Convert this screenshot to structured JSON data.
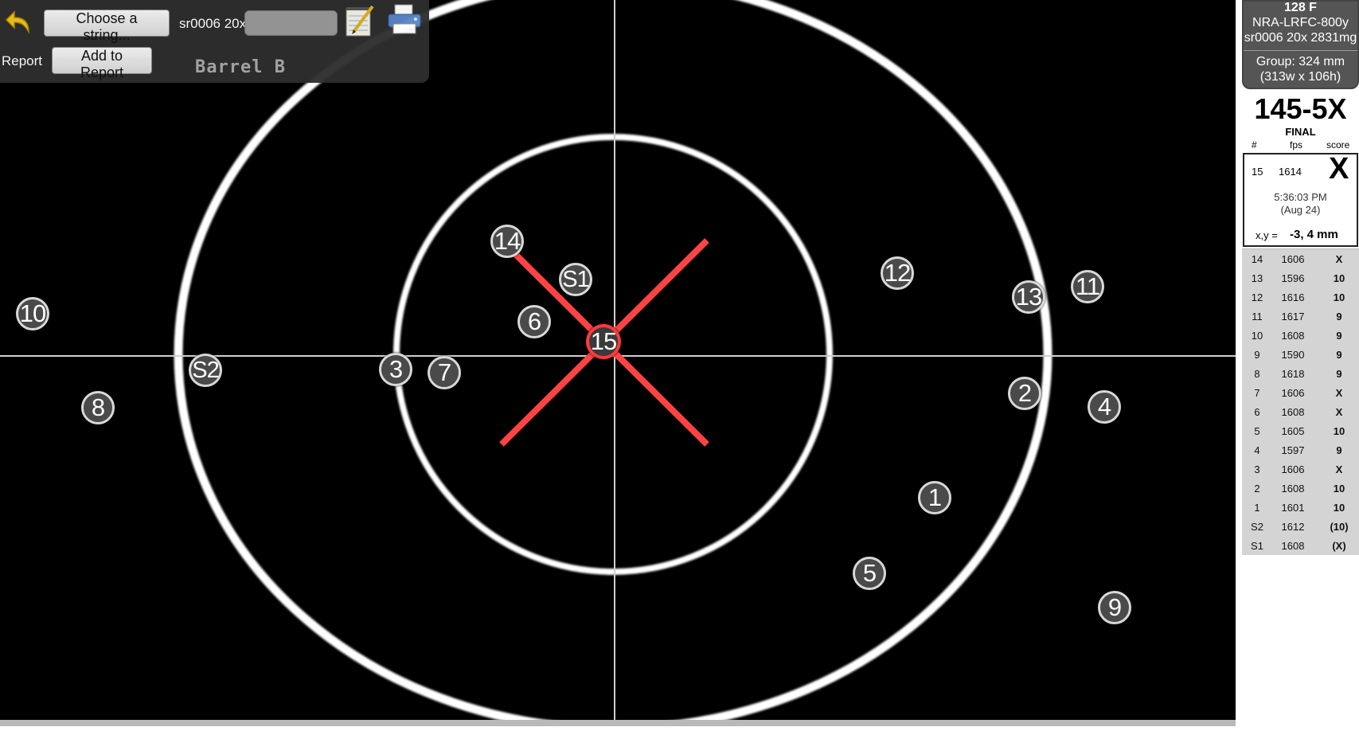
{
  "toolbar": {
    "choose_label": "Choose a string...",
    "string_prefix": "sr0006 20x",
    "report_label": "Report",
    "add_report_label": "Add to Report",
    "barrel_label": "Barrel B",
    "icons": [
      "undo-arrow-icon",
      "notepad-icon",
      "printer-icon"
    ]
  },
  "panel": {
    "temp": "128 F",
    "match": "NRA-LRFC-800y",
    "string": "sr0006 20x 2831mg",
    "group": "Group: 324 mm",
    "group_dims": "(313w x 106h)",
    "total": "145-5X",
    "status": "FINAL",
    "headers": {
      "num": "#",
      "fps": "fps",
      "score": "score"
    },
    "last_shot": {
      "num": "15",
      "fps": "1614",
      "score": "X",
      "time": "5:36:03 PM",
      "date": "(Aug 24)",
      "xy_label": "x,y =",
      "xy_value": "-3, 4 mm"
    },
    "rows": [
      {
        "num": "14",
        "fps": "1606",
        "score": "X"
      },
      {
        "num": "13",
        "fps": "1596",
        "score": "10"
      },
      {
        "num": "12",
        "fps": "1616",
        "score": "10"
      },
      {
        "num": "11",
        "fps": "1617",
        "score": "9"
      },
      {
        "num": "10",
        "fps": "1608",
        "score": "9"
      },
      {
        "num": "9",
        "fps": "1590",
        "score": "9"
      },
      {
        "num": "8",
        "fps": "1618",
        "score": "9"
      },
      {
        "num": "7",
        "fps": "1606",
        "score": "X"
      },
      {
        "num": "6",
        "fps": "1608",
        "score": "X"
      },
      {
        "num": "5",
        "fps": "1605",
        "score": "10"
      },
      {
        "num": "4",
        "fps": "1597",
        "score": "9"
      },
      {
        "num": "3",
        "fps": "1606",
        "score": "X"
      },
      {
        "num": "2",
        "fps": "1608",
        "score": "10"
      },
      {
        "num": "1",
        "fps": "1601",
        "score": "10"
      },
      {
        "num": "S2",
        "fps": "1612",
        "score": "(10)"
      },
      {
        "num": "S1",
        "fps": "1608",
        "score": "(X)"
      }
    ]
  },
  "target": {
    "shots": [
      {
        "label": "14"
      },
      {
        "label": "S1"
      },
      {
        "label": "6"
      },
      {
        "label": "15"
      },
      {
        "label": "12"
      },
      {
        "label": "13"
      },
      {
        "label": "11"
      },
      {
        "label": "10"
      },
      {
        "label": "S2"
      },
      {
        "label": "3"
      },
      {
        "label": "7"
      },
      {
        "label": "8"
      },
      {
        "label": "2"
      },
      {
        "label": "4"
      },
      {
        "label": "1"
      },
      {
        "label": "5"
      },
      {
        "label": "9"
      }
    ]
  }
}
